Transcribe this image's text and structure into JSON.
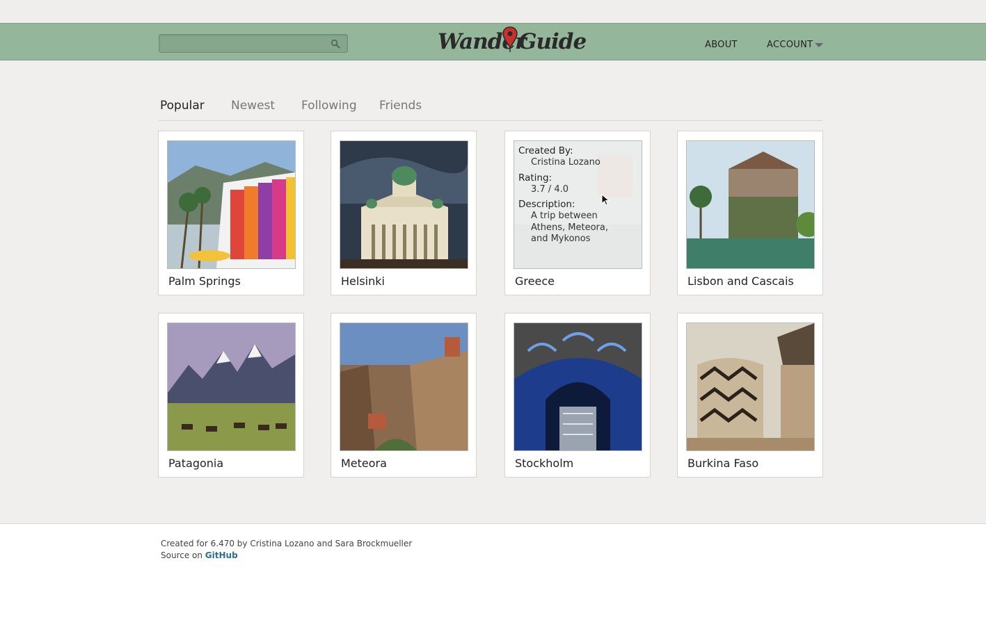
{
  "header": {
    "search_placeholder": "",
    "logo_left": "Wander",
    "logo_right": "Guide",
    "nav": {
      "about": "ABOUT",
      "account": "ACCOUNT"
    }
  },
  "tabs": [
    {
      "label": "Popular",
      "active": true
    },
    {
      "label": "Newest",
      "active": false
    },
    {
      "label": "Following",
      "active": false
    },
    {
      "label": "Friends",
      "active": false
    }
  ],
  "cards": [
    {
      "title": "Palm Springs"
    },
    {
      "title": "Helsinki"
    },
    {
      "title": "Greece",
      "hover": {
        "created_by_label": "Created By:",
        "created_by": "Cristina Lozano",
        "rating_label": "Rating:",
        "rating": "3.7 / 4.0",
        "description_label": "Description:",
        "description": "A trip between Athens, Meteora, and Mykonos"
      }
    },
    {
      "title": "Lisbon and Cascais"
    },
    {
      "title": "Patagonia"
    },
    {
      "title": "Meteora"
    },
    {
      "title": "Stockholm"
    },
    {
      "title": "Burkina Faso"
    }
  ],
  "footer": {
    "credit": "Created for 6.470 by Cristina Lozano and Sara Brockmueller",
    "source_prefix": "Source on ",
    "source_link": "GitHub"
  },
  "colors": {
    "header_bg": "#94b69a",
    "link": "#2a6f8f",
    "pin": "#c9302c"
  }
}
